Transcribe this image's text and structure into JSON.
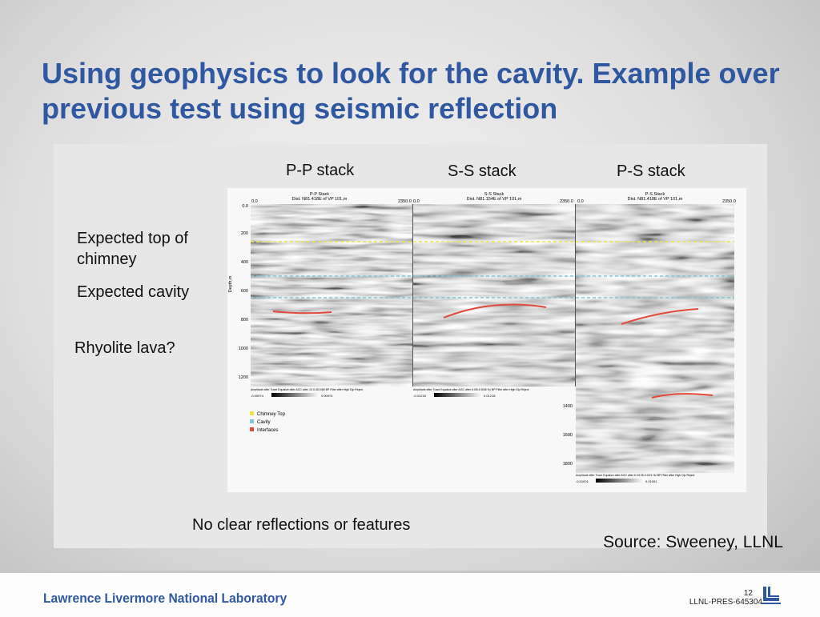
{
  "slide": {
    "title": "Using geophysics to look for the cavity. Example over previous test using seismic reflection",
    "labels": {
      "top_chimney": "Expected top of chimney",
      "cavity": "Expected cavity",
      "rhyolite": "Rhyolite lava?",
      "no_clear": "No clear reflections or features"
    },
    "stack_headers": [
      "P-P stack",
      "S-S stack",
      "P-S stack"
    ],
    "panel": {
      "subtitles": [
        {
          "name": "P-P Stack",
          "dist": "Dist. N81.418E of VP 101,m"
        },
        {
          "name": "S-S Stack",
          "dist": "Dist. N81.154E of VP 101,m"
        },
        {
          "name": "P-S Stack",
          "dist": "Dist. N81.418E of VP 101,m"
        }
      ],
      "dist_start": "0.0",
      "dist_end": "2350.0",
      "depth_axis_label": "Depth,m",
      "depth_ticks_upper": [
        "0.0",
        "200",
        "400",
        "600",
        "800",
        "1000",
        "1200"
      ],
      "depth_ticks_lower": [
        "1400",
        "1600",
        "1800"
      ],
      "legend": [
        {
          "label": "Chimney Top",
          "color": "#f2e24a"
        },
        {
          "label": "Cavity",
          "color": "#7fc8dc"
        },
        {
          "label": "Interfaces",
          "color": "#e04a3a"
        }
      ],
      "amp_captions": [
        "Amplitude after Trace Equalize after AGC after 10.0-45.0/65 BP Filter after High Dip Reject",
        "Amplitude after Trace Equalize after AGC after 6.0/5-0.5/45 Hz BP Filter after High Dip Reject",
        "Amplitude after Trace Equalize after AGC after 6.0/125-0.0/21 Hz BP Filter after High Dip Reject"
      ],
      "amp_ranges": [
        [
          "-0.00974",
          "0.00974"
        ],
        [
          "-0.01218",
          "0.01218"
        ],
        [
          "-0.01001",
          "0.01001"
        ]
      ]
    },
    "source": "Source: Sweeney, LLNL",
    "footer": {
      "lab": "Lawrence Livermore National Laboratory",
      "page": "12",
      "code": "LLNL-PRES-645304"
    },
    "colors": {
      "title": "#2f58a0",
      "chimney": "#f2e24a",
      "cavity": "#7fc8dc",
      "interface": "#e04a3a"
    }
  }
}
